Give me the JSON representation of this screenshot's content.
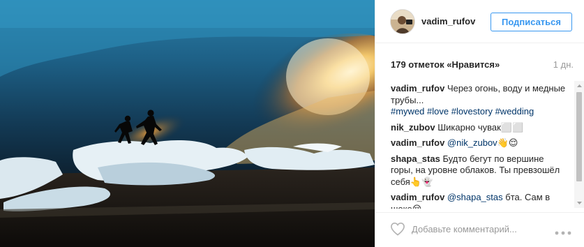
{
  "post": {
    "username": "vadim_rufov",
    "follow_label": "Подписаться",
    "likes_text": "179 отметок «Нравится»",
    "time_ago": "1 дн.",
    "image_icon": "photo-couple-on-ice"
  },
  "comments": [
    {
      "user": "vadim_rufov",
      "text": "Через огонь, воду и медные трубы...",
      "hashtags": "#mywed #love #lovestory #wedding",
      "mention": "",
      "tail": ""
    },
    {
      "user": "nik_zubov",
      "text": "Шикарно чувак⬜⬜",
      "hashtags": "",
      "mention": "",
      "tail": ""
    },
    {
      "user": "vadim_rufov",
      "text": "",
      "hashtags": "",
      "mention": "@nik_zubov",
      "tail": "👋😌"
    },
    {
      "user": "shapa_stas",
      "text": "Будто бегут по вершине горы, на уровне облаков. Ты превзошёл себя👆👻",
      "hashtags": "",
      "mention": "",
      "tail": ""
    },
    {
      "user": "vadim_rufov",
      "text": "",
      "hashtags": "",
      "mention": "@shapa_stas",
      "tail": "бта. Сам в шоке😌"
    }
  ],
  "composer": {
    "placeholder": "Добавьте комментарий...",
    "heart_icon": "heart-icon",
    "more_icon": "more-options-icon"
  },
  "colors": {
    "accent": "#3897f0",
    "link": "#003569",
    "muted": "#999999",
    "text": "#262626"
  }
}
